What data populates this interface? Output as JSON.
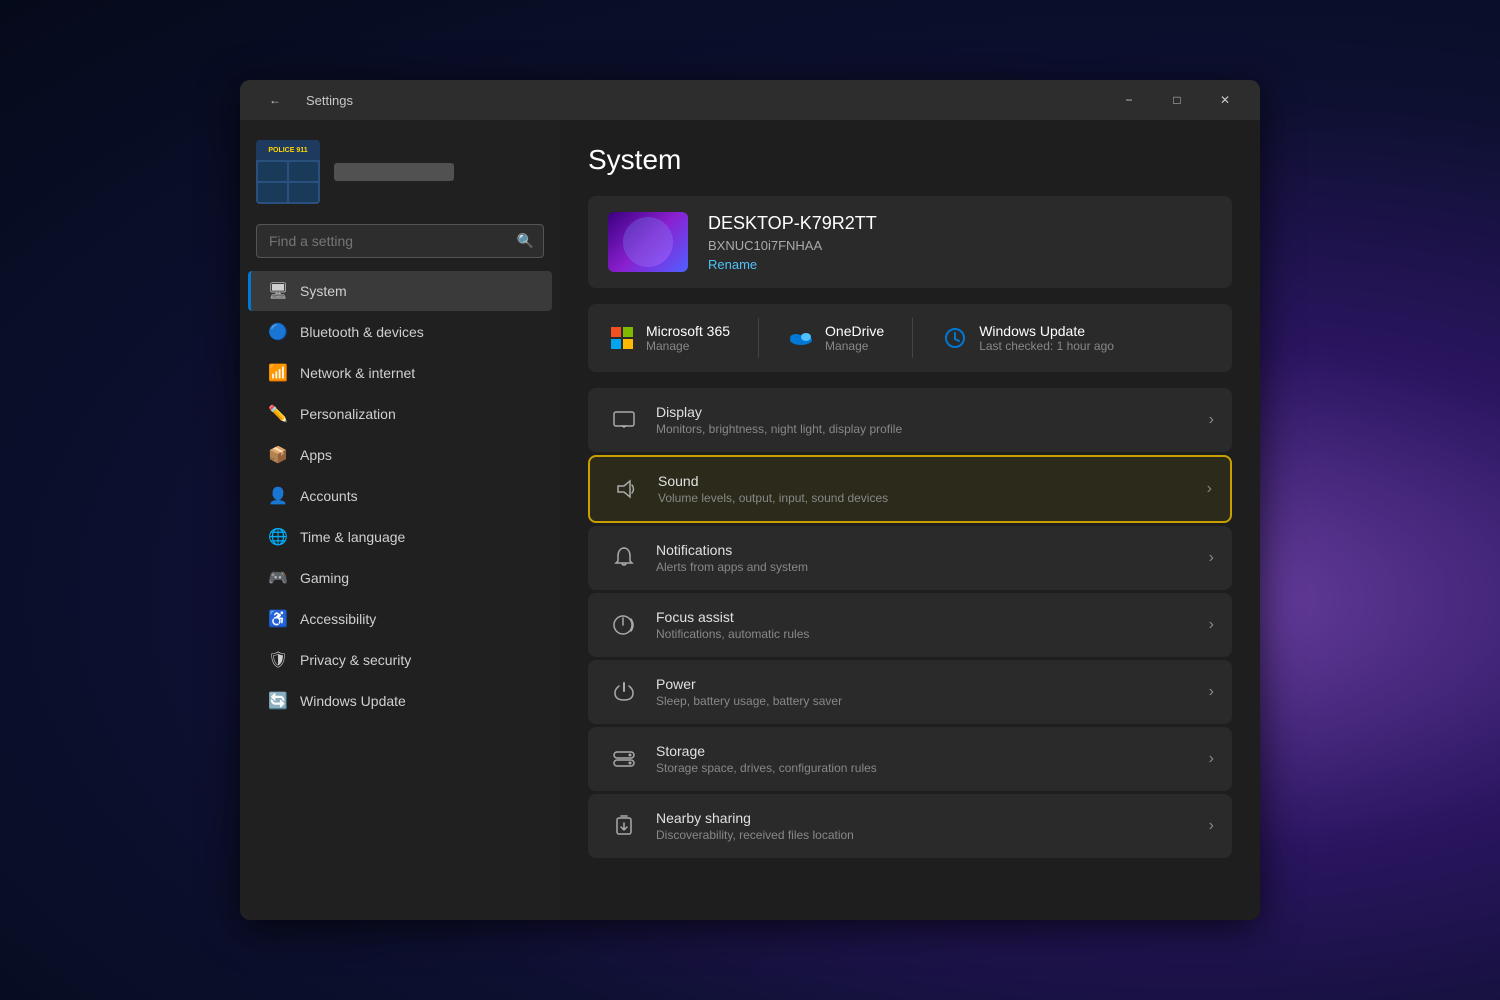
{
  "window": {
    "title": "Settings",
    "min_label": "−",
    "max_label": "□",
    "close_label": "✕",
    "back_label": "←"
  },
  "sidebar": {
    "search_placeholder": "Find a setting",
    "user": {
      "avatar_label": "POLICE 911",
      "username_blur": true
    },
    "nav_items": [
      {
        "id": "system",
        "label": "System",
        "icon": "🖥",
        "active": true
      },
      {
        "id": "bluetooth",
        "label": "Bluetooth & devices",
        "icon": "🔵"
      },
      {
        "id": "network",
        "label": "Network & internet",
        "icon": "📶"
      },
      {
        "id": "personalization",
        "label": "Personalization",
        "icon": "✏️"
      },
      {
        "id": "apps",
        "label": "Apps",
        "icon": "📦"
      },
      {
        "id": "accounts",
        "label": "Accounts",
        "icon": "👤"
      },
      {
        "id": "time",
        "label": "Time & language",
        "icon": "🌐"
      },
      {
        "id": "gaming",
        "label": "Gaming",
        "icon": "🎮"
      },
      {
        "id": "accessibility",
        "label": "Accessibility",
        "icon": "♿"
      },
      {
        "id": "privacy",
        "label": "Privacy & security",
        "icon": "🛡"
      },
      {
        "id": "update",
        "label": "Windows Update",
        "icon": "🔄"
      }
    ]
  },
  "main": {
    "title": "System",
    "device": {
      "name": "DESKTOP-K79R2TT",
      "sub": "BXNUC10i7FNHAA",
      "rename_label": "Rename"
    },
    "quick_links": [
      {
        "id": "microsoft365",
        "title": "Microsoft 365",
        "sub": "Manage",
        "icon_color": "#f25022"
      },
      {
        "id": "onedrive",
        "title": "OneDrive",
        "sub": "Manage",
        "icon_color": "#0078d4"
      },
      {
        "id": "windowsupdate",
        "title": "Windows Update",
        "sub": "Last checked: 1 hour ago",
        "icon_color": "#0078d4"
      }
    ],
    "settings": [
      {
        "id": "display",
        "title": "Display",
        "desc": "Monitors, brightness, night light, display profile",
        "icon": "🖥",
        "highlighted": false
      },
      {
        "id": "sound",
        "title": "Sound",
        "desc": "Volume levels, output, input, sound devices",
        "icon": "🔊",
        "highlighted": true
      },
      {
        "id": "notifications",
        "title": "Notifications",
        "desc": "Alerts from apps and system",
        "icon": "🔔",
        "highlighted": false
      },
      {
        "id": "focus",
        "title": "Focus assist",
        "desc": "Notifications, automatic rules",
        "icon": "🌙",
        "highlighted": false
      },
      {
        "id": "power",
        "title": "Power",
        "desc": "Sleep, battery usage, battery saver",
        "icon": "⏻",
        "highlighted": false
      },
      {
        "id": "storage",
        "title": "Storage",
        "desc": "Storage space, drives, configuration rules",
        "icon": "💾",
        "highlighted": false
      },
      {
        "id": "nearby",
        "title": "Nearby sharing",
        "desc": "Discoverability, received files location",
        "icon": "📤",
        "highlighted": false
      }
    ]
  }
}
